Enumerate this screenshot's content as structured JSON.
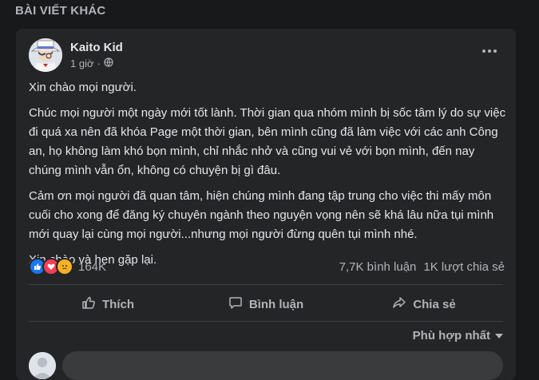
{
  "section": {
    "title": "BÀI VIẾT KHÁC"
  },
  "post": {
    "author": "Kaito Kid",
    "time": "1 giờ",
    "privacy_icon": "globe-icon",
    "paragraphs": [
      "Xin chào mọi người.",
      "Chúc mọi người một ngày mới tốt lành. Thời gian qua nhóm mình bị sốc tâm lý do sự việc đi quá xa nên đã khóa Page một thời gian, bên mình cũng đã làm việc với các anh Công an, họ không làm khó bọn mình, chỉ nhắc nhở và cũng vui vẻ với bọn mình, đến nay chúng mình vẫn ổn, không có chuyện bị gì đâu.",
      "Cảm ơn mọi người đã quan tâm, hiện chúng mình đang tập trung cho việc thi mấy môn cuối cho xong để đăng ký chuyên ngành theo nguyện vọng nên sẽ khá lâu nữa tụi mình mới quay lại cùng mọi người...nhưng mọi người đừng quên tụi mình nhé.",
      "Xin chào và hẹn gặp lại."
    ],
    "reactions": {
      "count": "164K",
      "icons": [
        "like-icon",
        "love-icon",
        "sad-icon"
      ],
      "comments": "7,7K bình luận",
      "shares": "1K lượt chia sẻ"
    },
    "actions": {
      "like": "Thích",
      "comment": "Bình luận",
      "share": "Chia sẻ"
    },
    "sort_label": "Phù hợp nhất"
  },
  "colors": {
    "background": "#18191a",
    "card": "#242526",
    "text": "#e4e6eb",
    "secondary_text": "#b0b3b8",
    "like": "#1877f2",
    "love": "#f33e58",
    "sad": "#f7b125"
  }
}
